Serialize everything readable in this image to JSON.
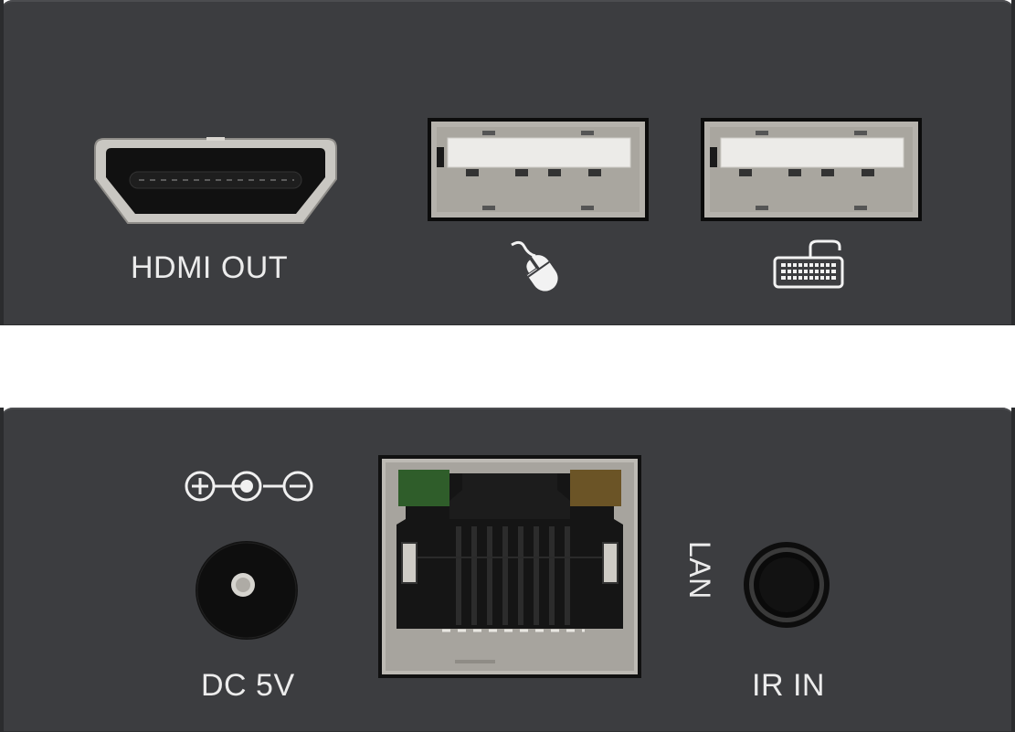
{
  "top_panel": {
    "hdmi_label": "HDMI OUT",
    "usb_ports": [
      {
        "icon": "mouse-icon"
      },
      {
        "icon": "keyboard-icon"
      }
    ]
  },
  "bottom_panel": {
    "dc_label": "DC 5V",
    "polarity_icon": "polarity-icon",
    "lan_label": "LAN",
    "ir_label": "IR IN"
  },
  "colors": {
    "panel": "#3c3d40",
    "label": "#ececec",
    "port_metal": "#b9b6b0",
    "usb_tongue": "#ecebe8",
    "led_green": "#2f5d2a",
    "led_amber": "#6b5426"
  }
}
